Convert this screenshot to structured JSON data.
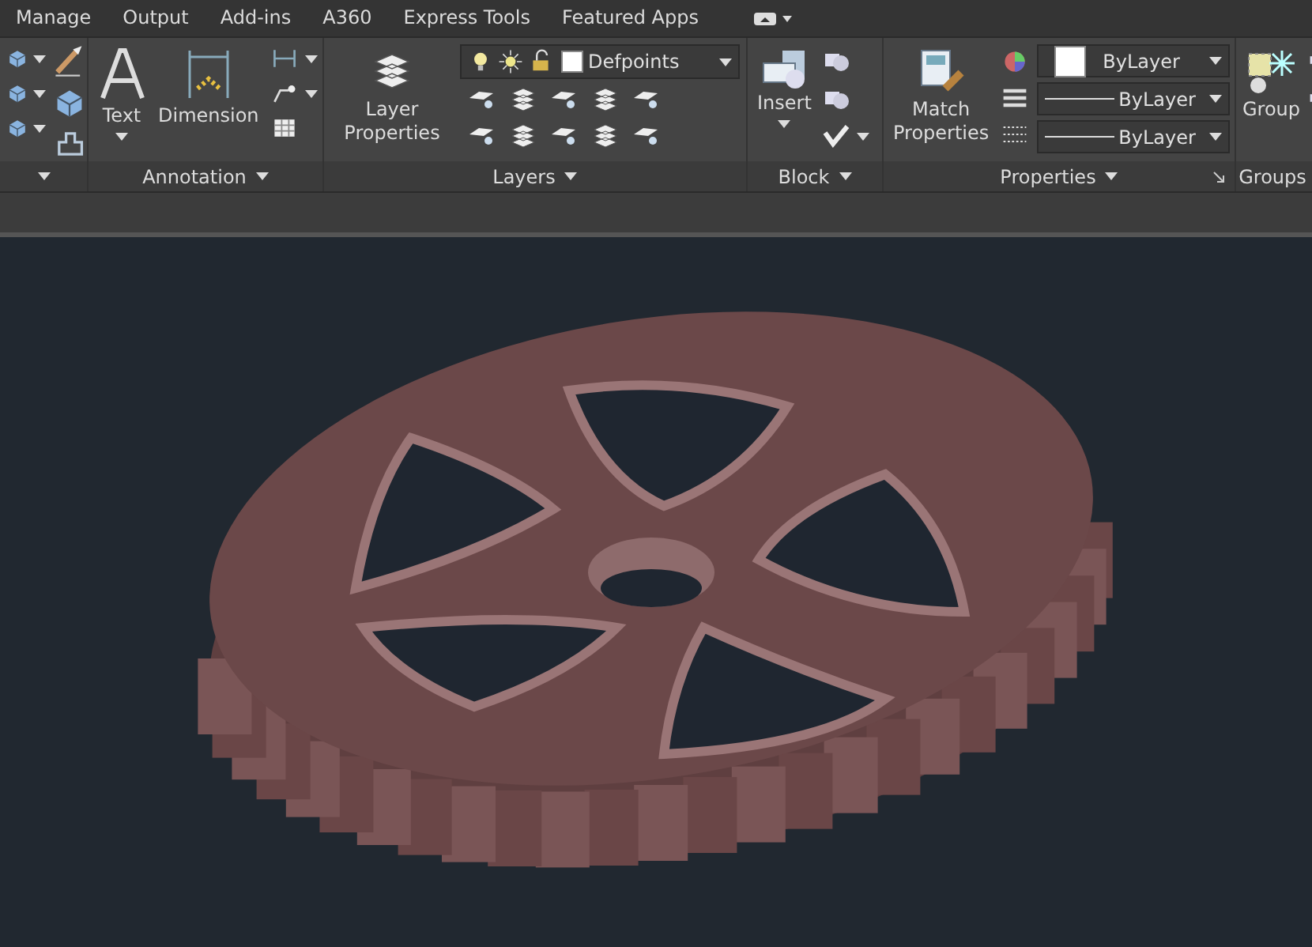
{
  "tabs": [
    {
      "label": "Manage",
      "selected": false
    },
    {
      "label": "Output",
      "selected": false
    },
    {
      "label": "Add-ins",
      "selected": false
    },
    {
      "label": "A360",
      "selected": false
    },
    {
      "label": "Express Tools",
      "selected": false
    },
    {
      "label": "Featured Apps",
      "selected": false
    }
  ],
  "ribbon": {
    "annotation": {
      "title": "Annotation",
      "buttons": [
        {
          "label": "Text",
          "kind": "text"
        },
        {
          "label": "Dimension",
          "kind": "dimension"
        }
      ]
    },
    "layers": {
      "title": "Layers",
      "button": "Layer Properties",
      "layer_dropdown": {
        "value": "Defpoints"
      }
    },
    "block": {
      "title": "Block",
      "button": "Insert"
    },
    "properties": {
      "title": "Properties",
      "button": "Match Properties",
      "dropdowns": [
        {
          "kind": "color",
          "value": "ByLayer"
        },
        {
          "kind": "linetype",
          "value": "ByLayer"
        },
        {
          "kind": "lineweight",
          "value": "ByLayer"
        }
      ]
    },
    "groups": {
      "title": "Groups",
      "button": "Group"
    }
  }
}
